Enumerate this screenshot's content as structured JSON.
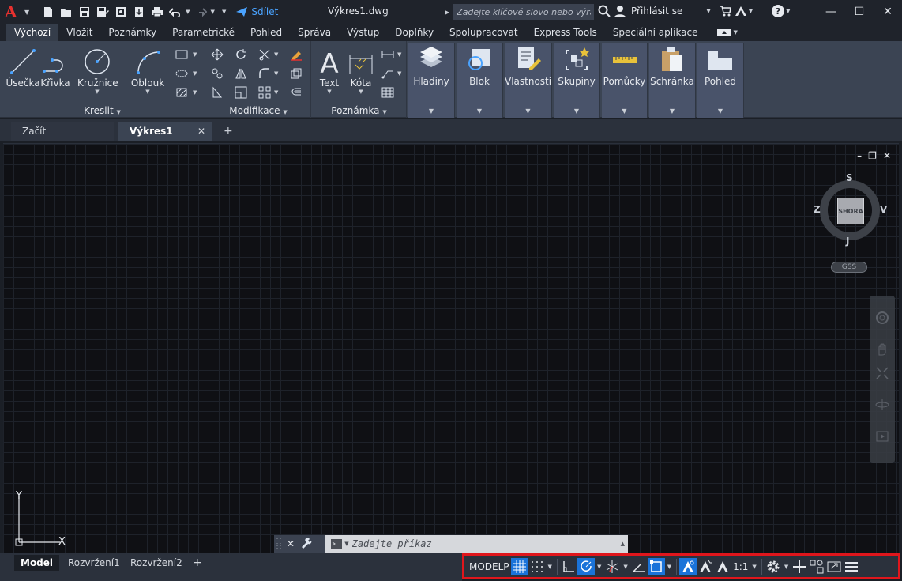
{
  "titlebar": {
    "share_label": "Sdílet",
    "doc_title": "Výkres1.dwg",
    "search_placeholder": "Zadejte klíčové slovo nebo výraz.",
    "signin_label": "Přihlásit se"
  },
  "ribbon_tabs": [
    "Výchozí",
    "Vložit",
    "Poznámky",
    "Parametrické",
    "Pohled",
    "Správa",
    "Výstup",
    "Doplňky",
    "Spolupracovat",
    "Express Tools",
    "Speciální aplikace"
  ],
  "ribbon": {
    "draw": {
      "title": "Kreslit",
      "line": "Úsečka",
      "polyline": "Křivka",
      "circle": "Kružnice",
      "arc": "Oblouk"
    },
    "modify": {
      "title": "Modifikace"
    },
    "annotation": {
      "title": "Poznámka",
      "text": "Text",
      "dimension": "Kóta"
    },
    "layers": "Hladiny",
    "block": "Blok",
    "properties": "Vlastnosti",
    "groups": "Skupiny",
    "utilities": "Pomůcky",
    "clipboard": "Schránka",
    "view": "Pohled"
  },
  "file_tabs": {
    "start": "Začít",
    "drawing": "Výkres1"
  },
  "viewcube": {
    "face": "SHORA",
    "north": "S",
    "south": "J",
    "west": "Z",
    "east": "V",
    "ucs_menu": "GSS"
  },
  "ucs": {
    "x": "X",
    "y": "Y"
  },
  "command": {
    "placeholder": "Zadejte příkaz"
  },
  "layout_tabs": [
    "Model",
    "Rozvržení1",
    "Rozvržení2"
  ],
  "statusbar": {
    "model": "MODELP",
    "scale": "1:1"
  },
  "colors": {
    "accent": "#1a73d9",
    "highlight_border": "#e0161c",
    "logo": "#e8312f"
  }
}
